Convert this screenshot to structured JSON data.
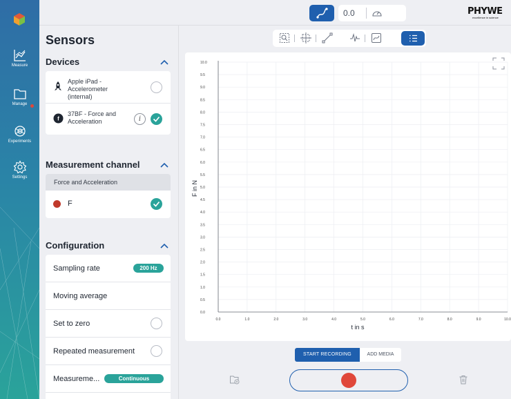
{
  "rail": {
    "items": [
      {
        "label": "Measure",
        "icon": "chart-icon"
      },
      {
        "label": "Manage",
        "icon": "folder-icon"
      },
      {
        "label": "Experiments",
        "icon": "experiments-icon"
      },
      {
        "label": "Settings",
        "icon": "gear-icon"
      }
    ]
  },
  "topbar": {
    "value_display": "0.0",
    "brand": "PHYWE",
    "brand_tagline": "excellence in science"
  },
  "sensors": {
    "title": "Sensors",
    "devices": {
      "title": "Devices",
      "items": [
        {
          "label": "Apple iPad - Accelerometer (internal)",
          "selected": false
        },
        {
          "label": "37BF - Force and Acceleration",
          "selected": true
        }
      ]
    },
    "channel": {
      "title": "Measurement channel",
      "header": "Force and Acceleration",
      "item": {
        "label": "F",
        "color": "#c0392b",
        "selected": true
      }
    },
    "config": {
      "title": "Configuration",
      "sampling_rate": {
        "label": "Sampling rate",
        "value": "200 Hz"
      },
      "moving_average": {
        "label": "Moving average"
      },
      "set_to_zero": {
        "label": "Set to zero"
      },
      "repeated": {
        "label": "Repeated measurement"
      },
      "mode": {
        "label": "Measureme...",
        "value": "Continuous"
      }
    }
  },
  "chart_data": {
    "type": "line",
    "xlabel": "t in s",
    "ylabel": "F in N",
    "xlim": [
      0,
      10
    ],
    "ylim": [
      0,
      10
    ],
    "xticks": [
      "0.0",
      "1.0",
      "2.0",
      "3.0",
      "4.0",
      "5.0",
      "6.0",
      "7.0",
      "8.0",
      "9.0",
      "10.0"
    ],
    "yticks": [
      "0.0",
      "0.5",
      "1.0",
      "1.5",
      "2.0",
      "2.5",
      "3.0",
      "3.5",
      "4.0",
      "4.5",
      "5.0",
      "5.5",
      "6.0",
      "6.5",
      "7.0",
      "7.5",
      "8.0",
      "8.5",
      "9.0",
      "9.5",
      "10.0"
    ],
    "grid": true,
    "series": []
  },
  "controls": {
    "start": "START RECORDING",
    "media": "ADD MEDIA"
  },
  "colors": {
    "accent": "#1f5fae",
    "teal": "#2aa39a",
    "record": "#e0473a"
  }
}
